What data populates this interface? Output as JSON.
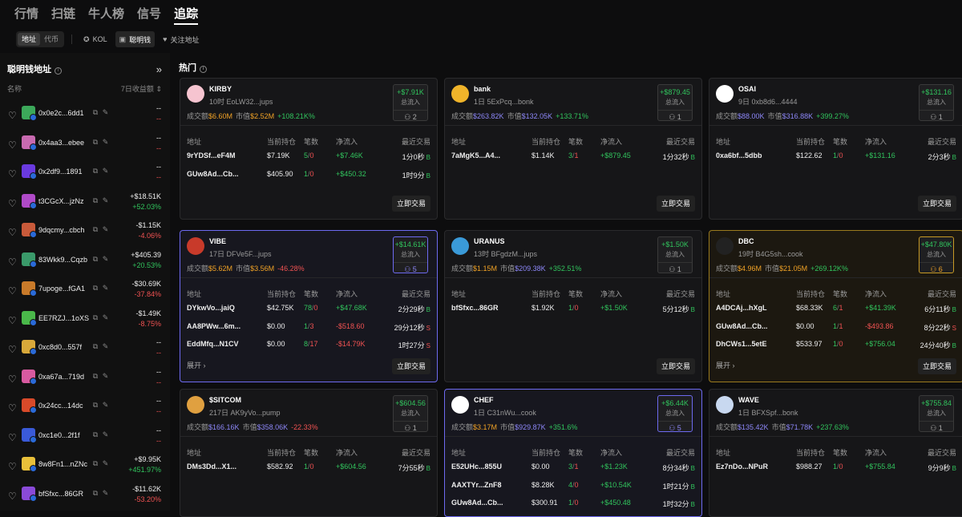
{
  "topnav": [
    "行情",
    "扫链",
    "牛人榜",
    "信号",
    "追踪"
  ],
  "subnav": {
    "seg": [
      "地址",
      "代币"
    ],
    "kol": "KOL",
    "smart": "聪明钱",
    "watch": "关注地址"
  },
  "sidebar": {
    "title": "聪明钱地址",
    "col_name": "名称",
    "col_pnl": "7日收益额",
    "rows": [
      {
        "name": "0x0e2c...6dd1",
        "v1": "--",
        "v2": "--",
        "color": "#3ca85a"
      },
      {
        "name": "0x4aa3...ebee",
        "v1": "--",
        "v2": "--",
        "color": "#c86ab0"
      },
      {
        "name": "0x2df9...1891",
        "v1": "--",
        "v2": "--",
        "color": "#6a3ae0"
      },
      {
        "name": "t3CGcX...jzNz",
        "v1": "+$18.51K",
        "v2": "+52.03%",
        "color": "#b04ac8"
      },
      {
        "name": "9dqcmy...cbch",
        "v1": "-$1.15K",
        "v2": "-4.06%",
        "color": "#c85a3a"
      },
      {
        "name": "83Wkk9...Cqzb",
        "v1": "+$405.39",
        "v2": "+20.53%",
        "color": "#3a9a6a"
      },
      {
        "name": "7upoge...fGA1",
        "v1": "-$30.69K",
        "v2": "-37.84%",
        "color": "#c87a2a"
      },
      {
        "name": "EE7RZJ...1oXS",
        "v1": "-$1.49K",
        "v2": "-8.75%",
        "color": "#4ab84a"
      },
      {
        "name": "0xc8d0...557f",
        "v1": "--",
        "v2": "--",
        "color": "#d8a83a"
      },
      {
        "name": "0xa67a...719d",
        "v1": "--",
        "v2": "--",
        "color": "#d85aa0"
      },
      {
        "name": "0x24cc...14dc",
        "v1": "--",
        "v2": "--",
        "color": "#d84a2a"
      },
      {
        "name": "0xc1e0...2f1f",
        "v1": "--",
        "v2": "--",
        "color": "#3a5ad8"
      },
      {
        "name": "8w8Fn1...nZNc",
        "v1": "+$9.95K",
        "v2": "+451.97%",
        "color": "#e8c03a"
      },
      {
        "name": "bfSfxc...86GR",
        "v1": "-$11.62K",
        "v2": "-53.20%",
        "color": "#8a4ad8"
      }
    ]
  },
  "main": {
    "title": "热门"
  },
  "labels": {
    "vol": "成交额",
    "mcap": "市值",
    "inflow": "总流入",
    "trade": "立即交易",
    "expand": "展开",
    "th": [
      "地址",
      "当前持仓",
      "笔数",
      "净流入",
      "最近交易"
    ]
  },
  "cards": [
    {
      "name": "KIRBY",
      "sub": "10时 EoLW32...jups",
      "vol": "$6.60M",
      "mcap": "$2.52M",
      "chg": "+108.21K%",
      "inflow": "+$7.91K",
      "count": "2",
      "rows": [
        [
          "9rYDSf...eF4M",
          "$7.19K",
          "5",
          "0",
          "+$7.46K",
          "1分0秒"
        ],
        [
          "GUw8Ad...Cb...",
          "$405.90",
          "1",
          "0",
          "+$450.32",
          "1时9分"
        ]
      ],
      "color": "#f6c4d0"
    },
    {
      "name": "bank",
      "sub": "1日 5ExPcq...bonk",
      "vol": "$263.82K",
      "mcap": "$132.05K",
      "chg": "+133.71%",
      "inflow": "+$879.45",
      "count": "1",
      "rows": [
        [
          "7aMgK5...A4...",
          "$1.14K",
          "3",
          "1",
          "+$879.45",
          "1分32秒"
        ]
      ],
      "color": "#f0b42a"
    },
    {
      "name": "OSAI",
      "sub": "9日 0xb8d6...4444",
      "vol": "$88.00K",
      "mcap": "$316.88K",
      "chg": "+399.27%",
      "inflow": "+$131.16",
      "count": "1",
      "rows": [
        [
          "0xa6bf...5dbb",
          "$122.62",
          "1",
          "0",
          "+$131.16",
          "2分3秒"
        ]
      ],
      "color": "#ffffff"
    },
    {
      "name": "VIBE",
      "sub": "17日 DFVe5F...jups",
      "vol": "$5.62M",
      "mcap": "$3.56M",
      "chg": "-46.28%",
      "inflow": "+$14.61K",
      "count": "5",
      "rows": [
        [
          "DYkwVo...jaiQ",
          "$42.75K",
          "78",
          "0",
          "+$47.68K",
          "2分29秒"
        ],
        [
          "AA8PWw...6m...",
          "$0.00",
          "1",
          "3",
          "-$518.60",
          "29分12秒"
        ],
        [
          "EddMfq...N1CV",
          "$0.00",
          "8",
          "17",
          "-$14.79K",
          "1时27分"
        ]
      ],
      "color": "#c83a2a"
    },
    {
      "name": "URANUS",
      "sub": "13时 BFgdzM...jups",
      "vol": "$1.15M",
      "mcap": "$209.38K",
      "chg": "+352.51%",
      "inflow": "+$1.50K",
      "count": "1",
      "rows": [
        [
          "bfSfxc...86GR",
          "$1.92K",
          "1",
          "0",
          "+$1.50K",
          "5分12秒"
        ]
      ],
      "color": "#3a9ad8"
    },
    {
      "name": "DBC",
      "sub": "19时 B4G5sh...cook",
      "vol": "$4.96M",
      "mcap": "$21.05M",
      "chg": "+269.12K%",
      "inflow": "+$47.80K",
      "count": "6",
      "rows": [
        [
          "A4DCAj...hXgL",
          "$68.33K",
          "6",
          "1",
          "+$41.39K",
          "6分11秒"
        ],
        [
          "GUw8Ad...Cb...",
          "$0.00",
          "1",
          "1",
          "-$493.86",
          "8分22秒"
        ],
        [
          "DhCWs1...5etE",
          "$533.97",
          "1",
          "0",
          "+$756.04",
          "24分40秒"
        ]
      ],
      "color": "#222222"
    },
    {
      "name": "$SITCOM",
      "sub": "217日 AK9yVo...pump",
      "vol": "$166.16K",
      "mcap": "$358.06K",
      "chg": "-22.33%",
      "inflow": "+$604.56",
      "count": "1",
      "rows": [
        [
          "DMs3Dd...X1...",
          "$582.92",
          "1",
          "0",
          "+$604.56",
          "7分55秒"
        ]
      ],
      "color": "#e0a040"
    },
    {
      "name": "CHEF",
      "sub": "1日 C31nWu...cook",
      "vol": "$3.17M",
      "mcap": "$929.87K",
      "chg": "+351.6%",
      "inflow": "+$6.44K",
      "count": "5",
      "rows": [
        [
          "E52UHc...855U",
          "$0.00",
          "3",
          "1",
          "+$1.23K",
          "8分34秒"
        ],
        [
          "AAXTYr...ZnF8",
          "$8.28K",
          "4",
          "0",
          "+$10.54K",
          "1时21分"
        ],
        [
          "GUw8Ad...Cb...",
          "$300.91",
          "1",
          "0",
          "+$450.48",
          "1时32分"
        ]
      ],
      "color": "#ffffff"
    },
    {
      "name": "WAVE",
      "sub": "1日 BFXSpf...bonk",
      "vol": "$135.42K",
      "mcap": "$71.78K",
      "chg": "+237.63%",
      "inflow": "+$755.84",
      "count": "1",
      "rows": [
        [
          "Ez7nDo...NPuR",
          "$988.27",
          "1",
          "0",
          "+$755.84",
          "9分9秒"
        ]
      ],
      "color": "#c8d8f0"
    }
  ]
}
